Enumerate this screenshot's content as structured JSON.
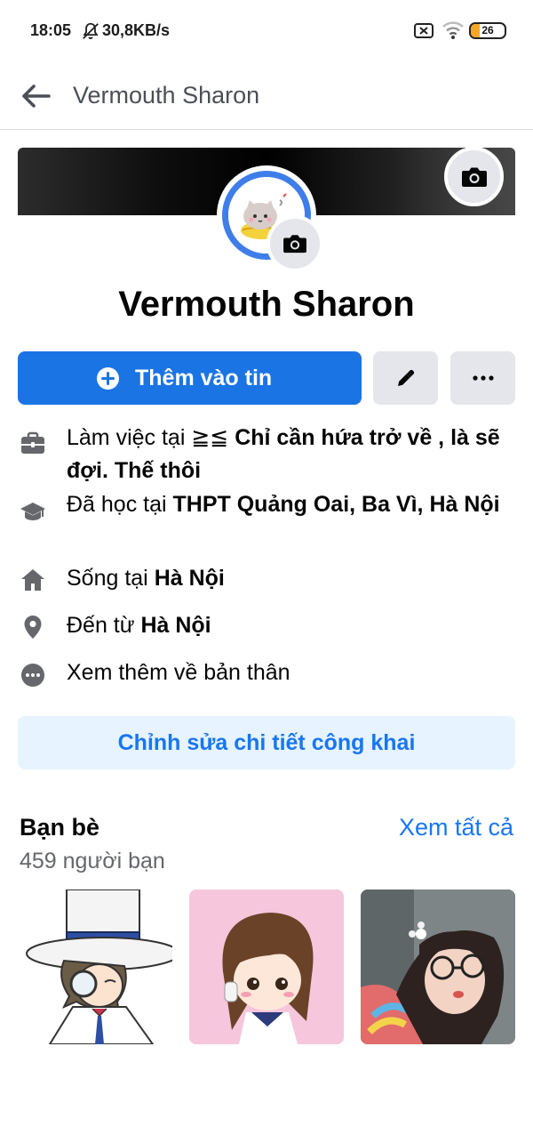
{
  "status_bar": {
    "time": "18:05",
    "network_speed": "30,8KB/s",
    "battery_level": "26",
    "battery_fraction": 0.26,
    "icons": [
      "bell-muted-icon",
      "sim-x-icon",
      "wifi-icon",
      "battery-icon"
    ]
  },
  "header": {
    "title": "Vermouth Sharon",
    "back_icon": "arrow-left-icon"
  },
  "profile": {
    "name": "Vermouth Sharon",
    "ring_color": "#3f7ee8"
  },
  "actions": {
    "add_story_label": "Thêm vào tin",
    "add_icon": "plus-circle-icon",
    "edit_icon": "pencil-icon",
    "more_icon": "ellipsis-icon",
    "primary_color": "#1b74e4"
  },
  "info": {
    "work_prefix": "Làm việc tại ",
    "work_value": "≧≦ Chỉ cần hứa trở về , là sẽ đợi. Thế thôi",
    "work_prefix_part2": "≧≦ ",
    "work_value_only": "Chỉ cần hứa trở về , là sẽ đợi. Thế thôi",
    "study_prefix": "Đã học tại ",
    "study_value": "THPT  Quảng Oai, Ba Vì, Hà Nội",
    "live_prefix": "Sống tại ",
    "live_value": "Hà Nội",
    "from_prefix": "Đến từ ",
    "from_value": "Hà Nội",
    "see_more": "Xem thêm về bản thân"
  },
  "edit_details_label": "Chỉnh sửa chi tiết công khai",
  "friends": {
    "title": "Bạn bè",
    "see_all": "Xem tất cả",
    "count": "459 người bạn"
  }
}
